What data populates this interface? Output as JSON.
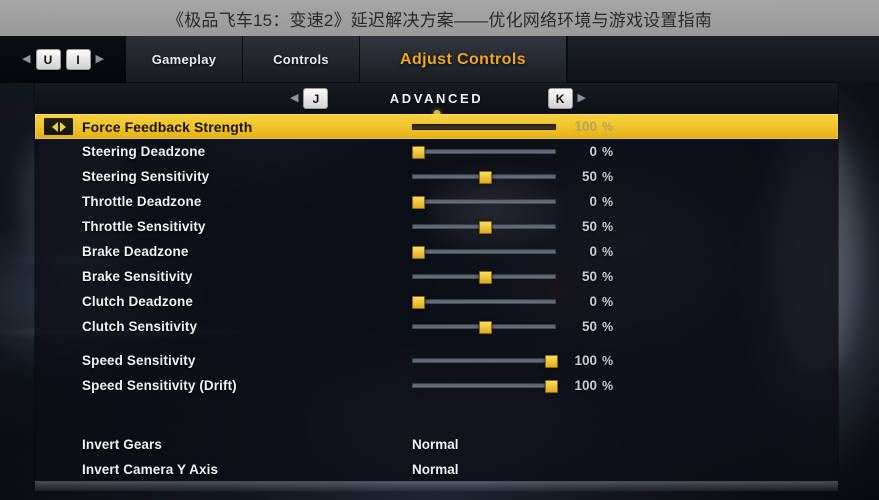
{
  "overlay_title": "《极品飞车15：变速2》延迟解决方案——优化网络环境与游戏设置指南",
  "nav": {
    "prev_arrow": "◀",
    "next_arrow": "▶",
    "prev_key": "U",
    "next_key": "I"
  },
  "tabs": [
    {
      "label": "Gameplay",
      "active": false
    },
    {
      "label": "Controls",
      "active": false
    },
    {
      "label": "Adjust Controls",
      "active": true
    }
  ],
  "section": {
    "title": "ADVANCED",
    "prev_arrow": "◀",
    "next_arrow": "▶",
    "prev_key": "J",
    "next_key": "K"
  },
  "units": {
    "percent": "%"
  },
  "settings": [
    {
      "label": "Force Feedback Strength",
      "value": "100",
      "pct": 100,
      "selected": true
    },
    {
      "label": "Steering Deadzone",
      "value": "0",
      "pct": 0,
      "selected": false
    },
    {
      "label": "Steering Sensitivity",
      "value": "50",
      "pct": 50,
      "selected": false
    },
    {
      "label": "Throttle Deadzone",
      "value": "0",
      "pct": 0,
      "selected": false
    },
    {
      "label": "Throttle Sensitivity",
      "value": "50",
      "pct": 50,
      "selected": false
    },
    {
      "label": "Brake Deadzone",
      "value": "0",
      "pct": 0,
      "selected": false
    },
    {
      "label": "Brake Sensitivity",
      "value": "50",
      "pct": 50,
      "selected": false
    },
    {
      "label": "Clutch Deadzone",
      "value": "0",
      "pct": 0,
      "selected": false
    },
    {
      "label": "Clutch Sensitivity",
      "value": "50",
      "pct": 50,
      "selected": false
    },
    {
      "label": "Speed Sensitivity",
      "value": "100",
      "pct": 100,
      "selected": false
    },
    {
      "label": "Speed Sensitivity (Drift)",
      "value": "100",
      "pct": 100,
      "selected": false
    }
  ],
  "options": [
    {
      "label": "Invert Gears",
      "value": "Normal"
    },
    {
      "label": "Invert Camera Y Axis",
      "value": "Normal"
    }
  ],
  "colors": {
    "accent_gold": "#f0a81c",
    "highlight_row": "#f0c32b",
    "knob": "#e0ac1b",
    "text_primary": "#eef1f5",
    "value_text": "#c9ced6",
    "panel_bg": "#0a0e15"
  }
}
